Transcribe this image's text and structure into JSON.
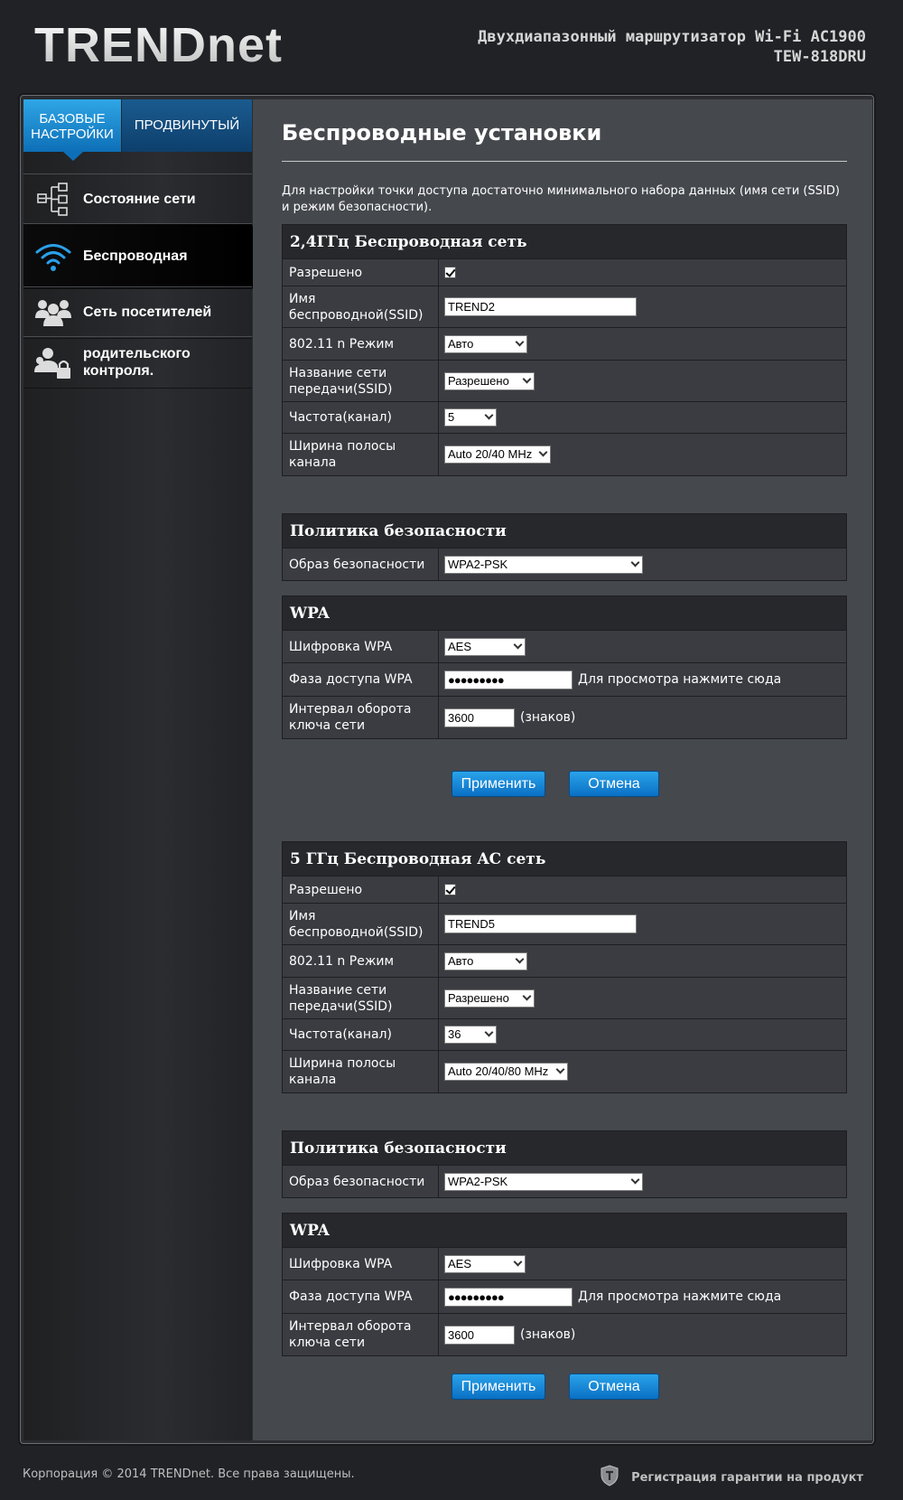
{
  "header": {
    "logo": "TRENDnet",
    "title_line1": "Двухдиапазонный маршрутизатор Wi-Fi AC1900",
    "title_line2": "TEW-818DRU"
  },
  "sidebar": {
    "tab_basic_line1": "БАЗОВЫЕ",
    "tab_basic_line2": "НАСТРОЙКИ",
    "tab_advanced": "ПРОДВИНУТЫЙ",
    "items": [
      {
        "label": "Состояние сети",
        "icon": "network-tree-icon"
      },
      {
        "label": "Беспроводная",
        "icon": "wifi-icon"
      },
      {
        "label": "Сеть посетителей",
        "icon": "guests-icon"
      },
      {
        "label_line1": "родительского",
        "label_line2": "контроля.",
        "icon": "parental-lock-icon"
      }
    ]
  },
  "main": {
    "title": "Беспроводные установки",
    "intro": "Для настройки точки доступа достаточно минимального набора данных (имя сети (SSID) и режим безопасности).",
    "band24": {
      "heading": "2,4ГГц Беспроводная сеть",
      "enabled_label": "Разрешено",
      "ssid_label": "Имя беспроводной(SSID)",
      "ssid_value": "TREND2",
      "mode_label": "802.11 n Режим",
      "mode_value": "Авто",
      "broadcast_label": "Название сети передачи(SSID)",
      "broadcast_value": "Разрешено",
      "channel_label": "Частота(канал)",
      "channel_value": "5",
      "width_label": "Ширина полосы канала",
      "width_value": "Auto 20/40 MHz",
      "security_heading": "Политика безопасности",
      "security_label": "Образ безопасности",
      "security_value": "WPA2-PSK",
      "wpa_heading": "WPA",
      "cipher_label": "Шифровка WPA",
      "cipher_value": "AES",
      "passphrase_label": "Фаза доступа WPA",
      "passphrase_value": "●●●●●●●●●",
      "passphrase_hint": "Для просмотра нажмите сюда",
      "rekey_label": "Интервал оборота ключа сети",
      "rekey_value": "3600",
      "rekey_unit": "(знаков)",
      "apply": "Применить",
      "cancel": "Отмена"
    },
    "band5": {
      "heading": "5 ГГц Беспроводная AC сеть",
      "enabled_label": "Разрешено",
      "ssid_label": "Имя беспроводной(SSID)",
      "ssid_value": "TREND5",
      "mode_label": "802.11 n Режим",
      "mode_value": "Авто",
      "broadcast_label": "Название сети передачи(SSID)",
      "broadcast_value": "Разрешено",
      "channel_label": "Частота(канал)",
      "channel_value": "36",
      "width_label": "Ширина полосы канала",
      "width_value": "Auto 20/40/80 MHz",
      "security_heading": "Политика безопасности",
      "security_label": "Образ безопасности",
      "security_value": "WPA2-PSK",
      "wpa_heading": "WPA",
      "cipher_label": "Шифровка WPA",
      "cipher_value": "AES",
      "passphrase_label": "Фаза доступа WPA",
      "passphrase_value": "●●●●●●●●●",
      "passphrase_hint": "Для просмотра нажмите сюда",
      "rekey_label": "Интервал оборота ключа сети",
      "rekey_value": "3600",
      "rekey_unit": "(знаков)",
      "apply": "Применить",
      "cancel": "Отмена"
    }
  },
  "footer": {
    "copyright": "Корпорация © 2014 TRENDnet. Все права защищены.",
    "warranty": "Регистрация гарантии на продукт"
  },
  "colors": {
    "accent": "#1a8fe0",
    "content_bg": "#45484d",
    "panel_head": "#27282c"
  }
}
